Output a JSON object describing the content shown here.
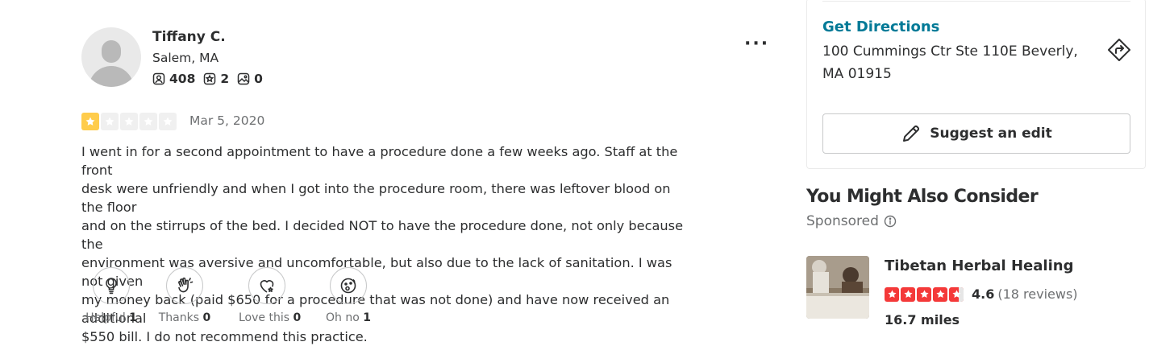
{
  "reviewer": {
    "name": "Tiffany C.",
    "location": "Salem, MA",
    "stats": {
      "friends": "408",
      "reviews": "2",
      "photos": "0"
    }
  },
  "review": {
    "rating": 1,
    "rating_max": 5,
    "date": "Mar 5, 2020",
    "text_lines": [
      "I went in for a second appointment to have a procedure done a few weeks ago. Staff at the front",
      "desk were unfriendly and when I got into the procedure room, there was leftover blood on the floor",
      "and on the stirrups of the bed. I decided NOT to have the procedure done, not only because the",
      "environment was aversive and uncomfortable, but also due to the lack of sanitation. I was not given",
      "my money back (paid $650 for a procedure that was not done) and have now received an additional",
      "$550 bill. I do not recommend this practice."
    ],
    "reactions": [
      {
        "label": "Helpful",
        "count": "1",
        "icon": "lightbulb-icon"
      },
      {
        "label": "Thanks",
        "count": "0",
        "icon": "clapping-hands-icon"
      },
      {
        "label": "Love this",
        "count": "0",
        "icon": "heart-icon"
      },
      {
        "label": "Oh no",
        "count": "1",
        "icon": "surprised-face-icon"
      }
    ]
  },
  "business_card": {
    "directions_label": "Get Directions",
    "address_line1": "100 Cummings Ctr Ste 110E Beverly,",
    "address_line2": "MA 01915",
    "suggest_edit_label": "Suggest an edit"
  },
  "sidebar": {
    "heading": "You Might Also Consider",
    "sponsored_label": "Sponsored",
    "ad": {
      "name": "Tibetan Herbal Healing",
      "rating": 4.5,
      "score": "4.6",
      "reviews": "(18 reviews)",
      "distance": "16.7 miles"
    }
  },
  "colors": {
    "link": "#027a97",
    "review_star": "#ffcc4b",
    "ad_star": "#f43939",
    "text": "#2d2e2f",
    "muted": "#6e7072"
  }
}
